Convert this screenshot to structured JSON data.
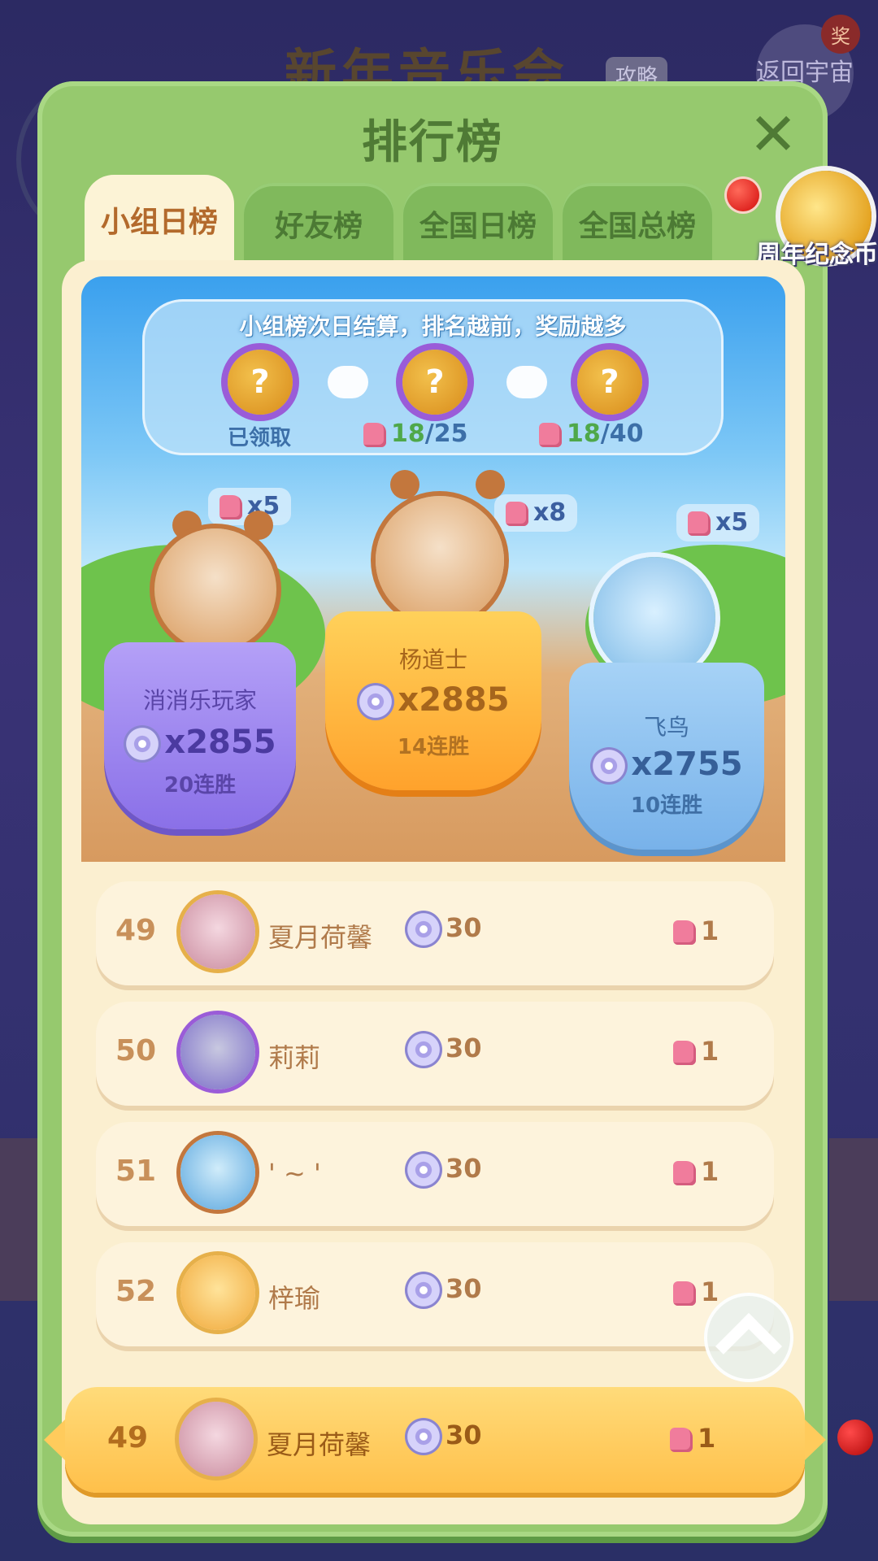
{
  "background": {
    "event_title": "新年音乐会",
    "guide_label": "攻略",
    "return_label": "返回宇宙",
    "prize_label": "奖"
  },
  "panel": {
    "title": "排行榜",
    "close_icon": "close-icon",
    "tabs": [
      {
        "label": "小组日榜",
        "active": true
      },
      {
        "label": "好友榜",
        "active": false
      },
      {
        "label": "全国日榜",
        "active": false
      },
      {
        "label": "全国总榜",
        "active": false
      }
    ]
  },
  "anniversary_coin": {
    "label": "周年纪念币"
  },
  "rewards": {
    "title": "小组榜次日结算，排名越前，奖励越多",
    "steps": [
      {
        "status": "已领取"
      },
      {
        "current": "18",
        "total": "/25"
      },
      {
        "current": "18",
        "total": "/40"
      }
    ]
  },
  "podium": [
    {
      "place": 2,
      "name": "消消乐玩家",
      "score": "x2855",
      "streak": "20连胜",
      "pieces": "x5"
    },
    {
      "place": 1,
      "name": "杨道士",
      "score": "x2885",
      "streak": "14连胜",
      "pieces": "x8"
    },
    {
      "place": 3,
      "name": "飞鸟",
      "score": "x2755",
      "streak": "10连胜",
      "pieces": "x5"
    }
  ],
  "rows": [
    {
      "rank": "49",
      "name": "夏月荷馨",
      "score": "30",
      "pieces": "1"
    },
    {
      "rank": "50",
      "name": "莉莉",
      "score": "30",
      "pieces": "1"
    },
    {
      "rank": "51",
      "name": "' ~ '",
      "score": "30",
      "pieces": "1"
    },
    {
      "rank": "52",
      "name": "梓瑜",
      "score": "30",
      "pieces": "1"
    }
  ],
  "my_row": {
    "rank": "49",
    "name": "夏月荷馨",
    "score": "30",
    "pieces": "1"
  },
  "colors": {
    "panel_green": "#96c96e",
    "tab_active": "#fcf3d6",
    "pedestal_first": "#ffb43a",
    "pedestal_second": "#a48cf2",
    "pedestal_third": "#8cc2f0"
  }
}
